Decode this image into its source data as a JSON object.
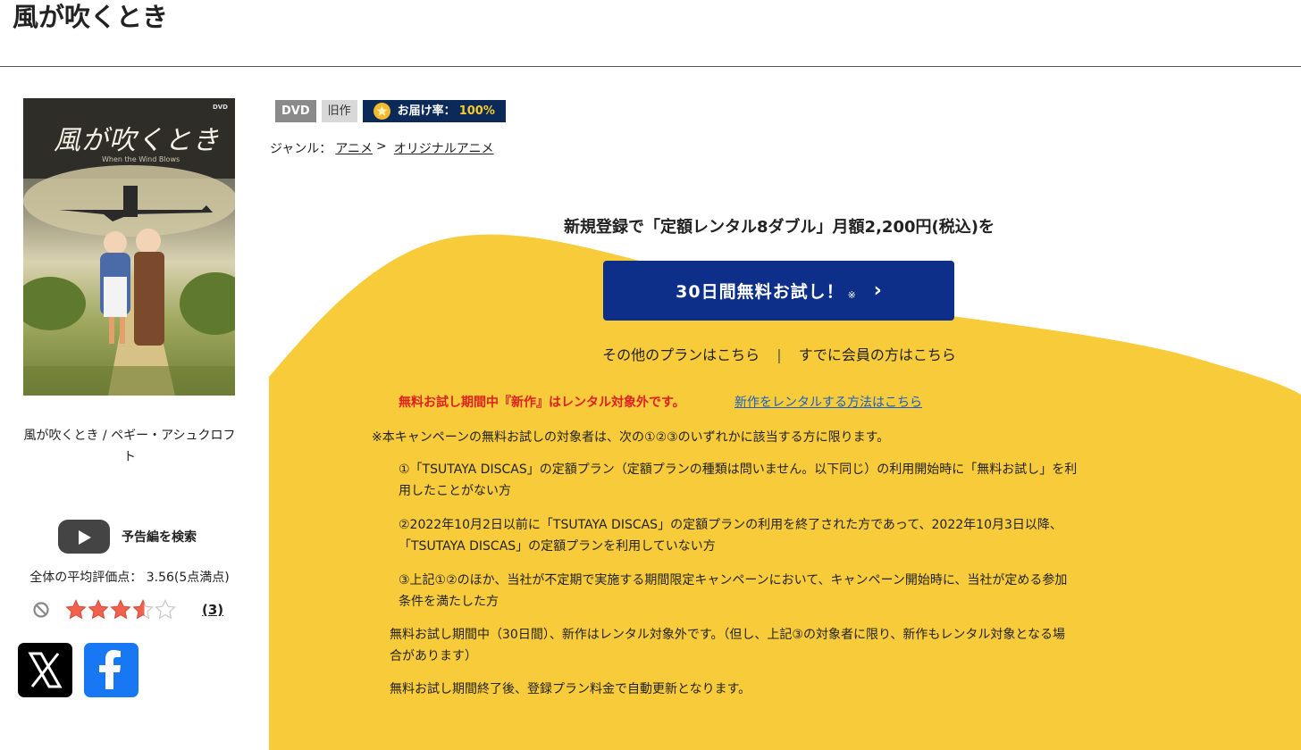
{
  "page": {
    "title": "風が吹くとき"
  },
  "product": {
    "poster_title": "風が吹くとき",
    "poster_sub": "When the Wind Blows",
    "caption": "風が吹くとき / ペギー・アシュクロフト",
    "trailer_label": "予告編を検索",
    "avg_rating_text": "全体の平均評価点： 3.56(5点満点)",
    "rating": 3.56,
    "rating_max": 5,
    "review_count": "(3)",
    "share": [
      {
        "name": "x",
        "icon": "x-logo-icon"
      },
      {
        "name": "facebook",
        "icon": "facebook-logo-icon"
      }
    ]
  },
  "badges": {
    "format": "DVD",
    "age": "旧作",
    "delivery_label": "お届け率：",
    "delivery_value": "100%"
  },
  "genre": {
    "label": "ジャンル：",
    "items": [
      "アニメ",
      "オリジナルアニメ"
    ],
    "separator": ">"
  },
  "campaign": {
    "headline": "新規登録で「定額レンタル8ダブル」月額2,200円(税込)を",
    "cta_label": "30日間無料お試し！",
    "cta_note": "※",
    "other_plans": "その他のプランはこちら",
    "separator": "|",
    "members": "すでに会員の方はこちら",
    "warning": "無料お試し期間中『新作』はレンタル対象外です。",
    "warning_link": "新作をレンタルする方法はこちら",
    "notice": "※本キャンペーンの無料お試しの対象者は、次の①②③のいずれかに該当する方に限ります。",
    "conditions": [
      [
        "①「TSUTAYA DISCAS」の定額プラン（定額プランの種類は問いません。以下同じ）の利用開始時に「無料お試し」を利",
        "用したことがない方"
      ],
      [
        "②2022年10月2日以前に「TSUTAYA DISCAS」の定額プランの利用を終了された方であって、2022年10月3日以降、",
        "「TSUTAYA DISCAS」の定額プランを利用していない方"
      ],
      [
        "③上記①②のほか、当社が不定期で実施する期間限定キャンペーンにおいて、キャンペーン開始時に、当社が定める参加",
        "条件を満たした方"
      ]
    ],
    "trial_note": [
      "無料お試し期間中（30日間）、新作はレンタル対象外です。（但し、上記③の対象者に限り、新作もレンタル対象となる場",
      "合があります）"
    ],
    "auto_renew": "無料お試し期間終了後、登録プラン料金で自動更新となります。"
  },
  "colors": {
    "campaign_bg": "#f8cb3a",
    "cta_bg": "#0d2f8a",
    "warning": "#e02020",
    "link": "#1a5fc4",
    "delivery_badge": "#0b2a58"
  }
}
